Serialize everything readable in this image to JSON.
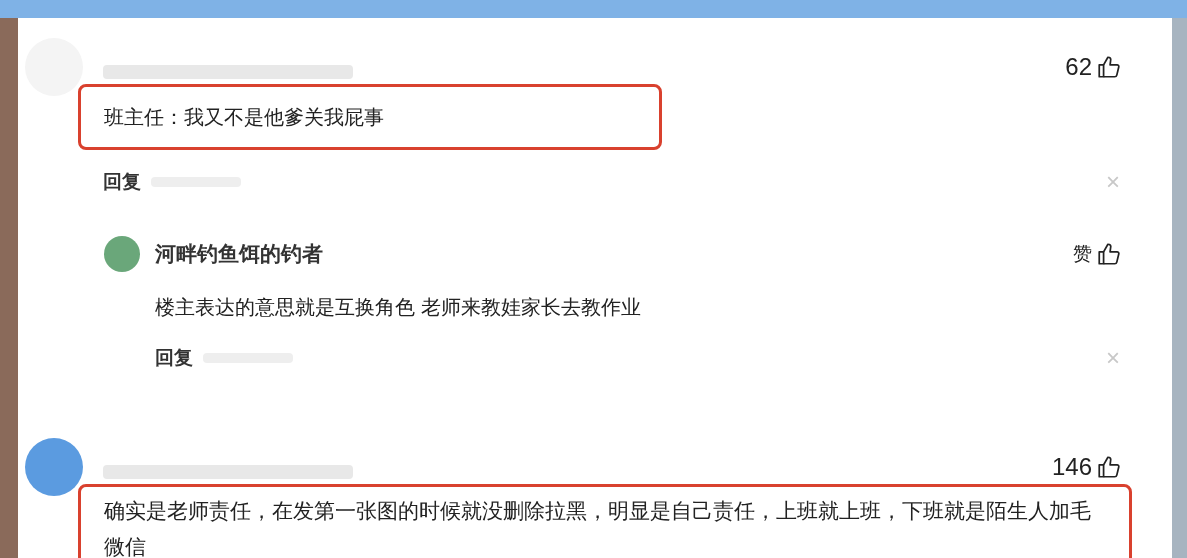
{
  "comments": [
    {
      "likes": "62",
      "text": "班主任：我又不是他爹关我屁事",
      "highlighted": true,
      "reply_label": "回复",
      "dismiss": "×",
      "replies": [
        {
          "name": "河畔钓鱼饵的钓者",
          "likes": "赞",
          "text": "楼主表达的意思就是互换角色 老师来教娃家长去教作业",
          "reply_label": "回复",
          "dismiss": "×"
        }
      ]
    },
    {
      "likes": "146",
      "text": "确实是老师责任，在发第一张图的时候就没删除拉黑，明显是自己责任，上班就上班，下班就是陌生人加毛微信",
      "highlighted": true
    }
  ]
}
